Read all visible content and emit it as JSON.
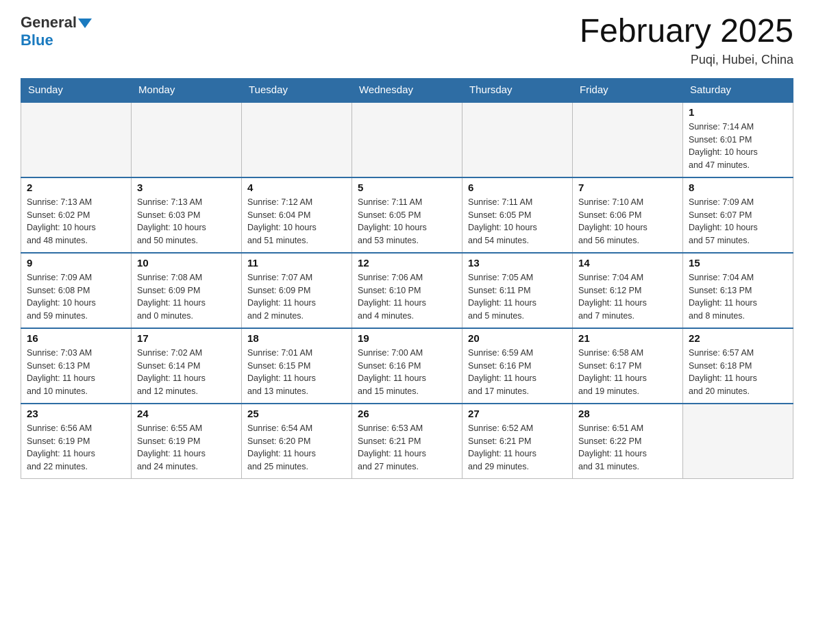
{
  "header": {
    "logo_general": "General",
    "logo_blue": "Blue",
    "month_title": "February 2025",
    "location": "Puqi, Hubei, China"
  },
  "weekdays": [
    "Sunday",
    "Monday",
    "Tuesday",
    "Wednesday",
    "Thursday",
    "Friday",
    "Saturday"
  ],
  "weeks": [
    [
      {
        "day": "",
        "info": ""
      },
      {
        "day": "",
        "info": ""
      },
      {
        "day": "",
        "info": ""
      },
      {
        "day": "",
        "info": ""
      },
      {
        "day": "",
        "info": ""
      },
      {
        "day": "",
        "info": ""
      },
      {
        "day": "1",
        "info": "Sunrise: 7:14 AM\nSunset: 6:01 PM\nDaylight: 10 hours\nand 47 minutes."
      }
    ],
    [
      {
        "day": "2",
        "info": "Sunrise: 7:13 AM\nSunset: 6:02 PM\nDaylight: 10 hours\nand 48 minutes."
      },
      {
        "day": "3",
        "info": "Sunrise: 7:13 AM\nSunset: 6:03 PM\nDaylight: 10 hours\nand 50 minutes."
      },
      {
        "day": "4",
        "info": "Sunrise: 7:12 AM\nSunset: 6:04 PM\nDaylight: 10 hours\nand 51 minutes."
      },
      {
        "day": "5",
        "info": "Sunrise: 7:11 AM\nSunset: 6:05 PM\nDaylight: 10 hours\nand 53 minutes."
      },
      {
        "day": "6",
        "info": "Sunrise: 7:11 AM\nSunset: 6:05 PM\nDaylight: 10 hours\nand 54 minutes."
      },
      {
        "day": "7",
        "info": "Sunrise: 7:10 AM\nSunset: 6:06 PM\nDaylight: 10 hours\nand 56 minutes."
      },
      {
        "day": "8",
        "info": "Sunrise: 7:09 AM\nSunset: 6:07 PM\nDaylight: 10 hours\nand 57 minutes."
      }
    ],
    [
      {
        "day": "9",
        "info": "Sunrise: 7:09 AM\nSunset: 6:08 PM\nDaylight: 10 hours\nand 59 minutes."
      },
      {
        "day": "10",
        "info": "Sunrise: 7:08 AM\nSunset: 6:09 PM\nDaylight: 11 hours\nand 0 minutes."
      },
      {
        "day": "11",
        "info": "Sunrise: 7:07 AM\nSunset: 6:09 PM\nDaylight: 11 hours\nand 2 minutes."
      },
      {
        "day": "12",
        "info": "Sunrise: 7:06 AM\nSunset: 6:10 PM\nDaylight: 11 hours\nand 4 minutes."
      },
      {
        "day": "13",
        "info": "Sunrise: 7:05 AM\nSunset: 6:11 PM\nDaylight: 11 hours\nand 5 minutes."
      },
      {
        "day": "14",
        "info": "Sunrise: 7:04 AM\nSunset: 6:12 PM\nDaylight: 11 hours\nand 7 minutes."
      },
      {
        "day": "15",
        "info": "Sunrise: 7:04 AM\nSunset: 6:13 PM\nDaylight: 11 hours\nand 8 minutes."
      }
    ],
    [
      {
        "day": "16",
        "info": "Sunrise: 7:03 AM\nSunset: 6:13 PM\nDaylight: 11 hours\nand 10 minutes."
      },
      {
        "day": "17",
        "info": "Sunrise: 7:02 AM\nSunset: 6:14 PM\nDaylight: 11 hours\nand 12 minutes."
      },
      {
        "day": "18",
        "info": "Sunrise: 7:01 AM\nSunset: 6:15 PM\nDaylight: 11 hours\nand 13 minutes."
      },
      {
        "day": "19",
        "info": "Sunrise: 7:00 AM\nSunset: 6:16 PM\nDaylight: 11 hours\nand 15 minutes."
      },
      {
        "day": "20",
        "info": "Sunrise: 6:59 AM\nSunset: 6:16 PM\nDaylight: 11 hours\nand 17 minutes."
      },
      {
        "day": "21",
        "info": "Sunrise: 6:58 AM\nSunset: 6:17 PM\nDaylight: 11 hours\nand 19 minutes."
      },
      {
        "day": "22",
        "info": "Sunrise: 6:57 AM\nSunset: 6:18 PM\nDaylight: 11 hours\nand 20 minutes."
      }
    ],
    [
      {
        "day": "23",
        "info": "Sunrise: 6:56 AM\nSunset: 6:19 PM\nDaylight: 11 hours\nand 22 minutes."
      },
      {
        "day": "24",
        "info": "Sunrise: 6:55 AM\nSunset: 6:19 PM\nDaylight: 11 hours\nand 24 minutes."
      },
      {
        "day": "25",
        "info": "Sunrise: 6:54 AM\nSunset: 6:20 PM\nDaylight: 11 hours\nand 25 minutes."
      },
      {
        "day": "26",
        "info": "Sunrise: 6:53 AM\nSunset: 6:21 PM\nDaylight: 11 hours\nand 27 minutes."
      },
      {
        "day": "27",
        "info": "Sunrise: 6:52 AM\nSunset: 6:21 PM\nDaylight: 11 hours\nand 29 minutes."
      },
      {
        "day": "28",
        "info": "Sunrise: 6:51 AM\nSunset: 6:22 PM\nDaylight: 11 hours\nand 31 minutes."
      },
      {
        "day": "",
        "info": ""
      }
    ]
  ]
}
